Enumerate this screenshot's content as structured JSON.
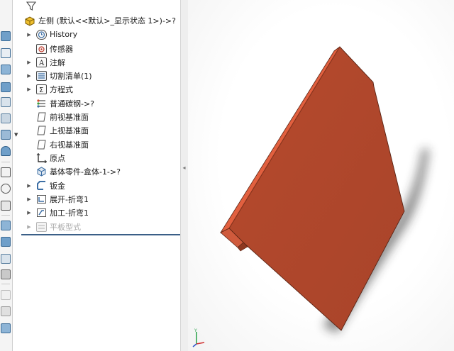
{
  "feature_tree": {
    "root_label": "左侧 (默认<<默认>_显示状态 1>)->?",
    "items": [
      {
        "label": "History",
        "expandable": true,
        "icon": "history-icon"
      },
      {
        "label": "传感器",
        "expandable": false,
        "icon": "sensor-icon"
      },
      {
        "label": "注解",
        "expandable": true,
        "icon": "annotation-icon"
      },
      {
        "label": "切割清单(1)",
        "expandable": true,
        "icon": "cut-list-icon"
      },
      {
        "label": "方程式",
        "expandable": true,
        "icon": "equations-icon"
      },
      {
        "label": "普通碳钢->?",
        "expandable": false,
        "icon": "material-icon"
      },
      {
        "label": "前视基准面",
        "expandable": false,
        "icon": "plane-icon"
      },
      {
        "label": "上视基准面",
        "expandable": false,
        "icon": "plane-icon"
      },
      {
        "label": "右视基准面",
        "expandable": false,
        "icon": "plane-icon"
      },
      {
        "label": "原点",
        "expandable": false,
        "icon": "origin-icon"
      },
      {
        "label": "基体零件-盒体-1->?",
        "expandable": true,
        "icon": "base-part-icon"
      },
      {
        "label": "钣金",
        "expandable": true,
        "icon": "sheet-metal-icon"
      },
      {
        "label": "展开-折弯1",
        "expandable": true,
        "icon": "unfold-icon"
      },
      {
        "label": "加工-折弯1",
        "expandable": true,
        "icon": "fold-icon"
      },
      {
        "label": "平板型式",
        "expandable": true,
        "icon": "flat-pattern-icon",
        "suppressed": true
      }
    ]
  },
  "colors": {
    "part_face": "#b94a2c",
    "part_edge_face": "#e2603f",
    "selection_line": "#3a5f87"
  }
}
